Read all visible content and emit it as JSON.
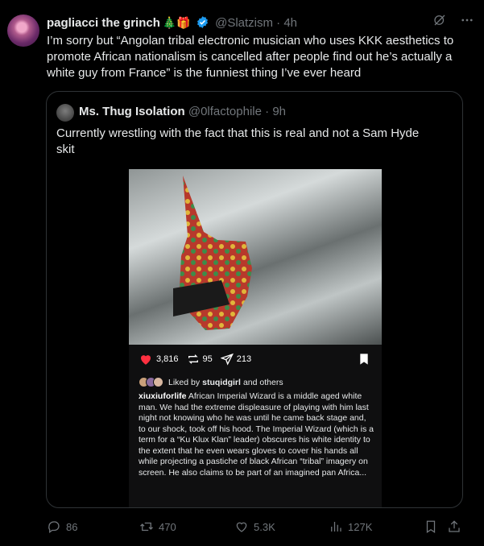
{
  "tweet": {
    "author_name": "pagliacci the grinch",
    "author_emoji": "🎄🎁",
    "handle": "@Slatzism",
    "separator": "·",
    "time": "4h",
    "text": "I’m sorry but “Angolan tribal electronic musician who uses KKK aesthetics to promote African nationalism is cancelled after people find out he’s actually a white guy from France” is the funniest thing I’ve ever heard"
  },
  "quote": {
    "author_name": "Ms. Thug Isolation",
    "handle": "@0lfactophile",
    "separator": "·",
    "time": "9h",
    "text": "Currently wrestling with the fact that this is real and not a Sam Hyde skit"
  },
  "embedded_post": {
    "likes": "3,816",
    "comments": "95",
    "shares": "213",
    "liked_by_prefix": "Liked by",
    "liked_by_user": "stuqidgirl",
    "liked_by_suffix": "and others",
    "caption_user": "xiuxiuforlife",
    "caption_text": "African Imperial Wizard is a middle aged white man. We had the extreme displeasure of playing with him last night not knowing who he was until he came back stage and, to our shock, took off his hood. The Imperial Wizard (which is a term for a “Ku Klux Klan” leader) obscures his white identity to the extent that he even wears gloves to cover his hands all while projecting a pastiche of black African “tribal” imagery on screen. He also claims to be part of an imagined pan Africa..."
  },
  "footer": {
    "replies": "86",
    "reposts": "470",
    "likes": "5.3K",
    "views": "127K"
  },
  "colors": {
    "background": "#000000",
    "text": "#e7e9ea",
    "muted": "#71767b",
    "verified": "#1d9bf0",
    "border": "#2f3336",
    "ig_heart": "#ff3040"
  }
}
